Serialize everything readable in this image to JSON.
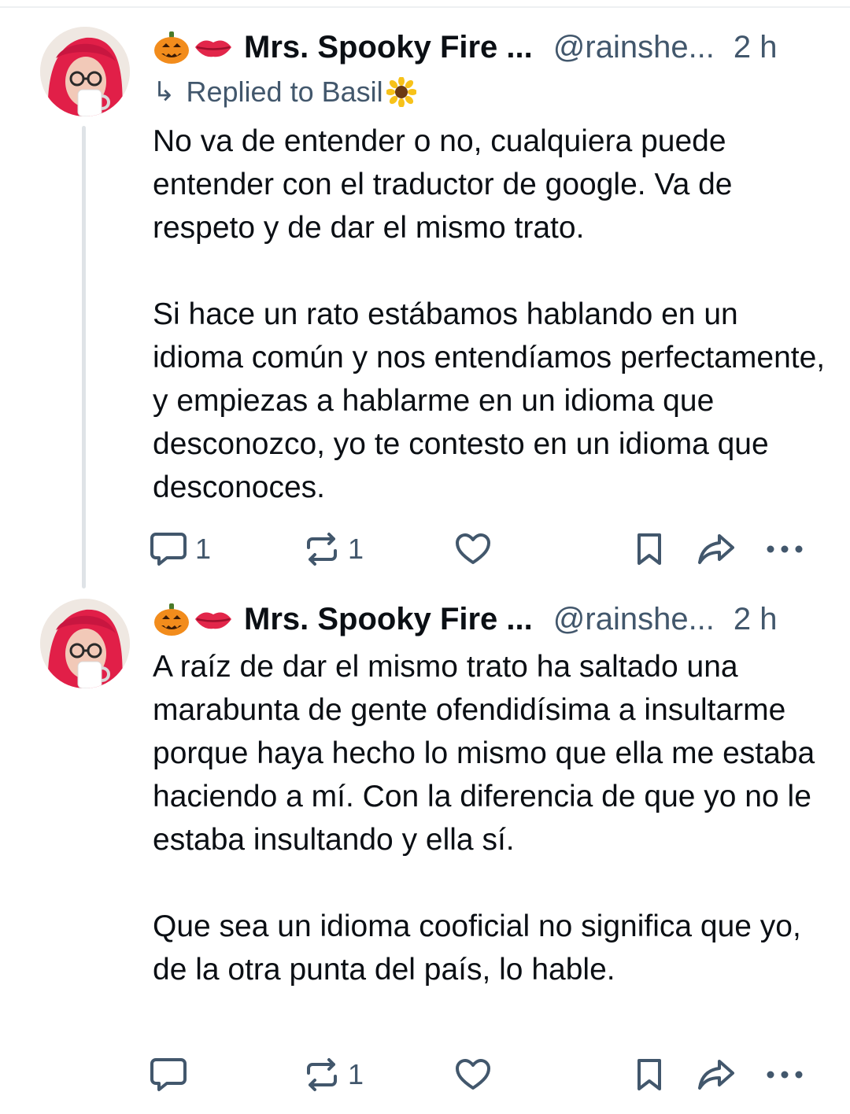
{
  "posts": [
    {
      "author_name": "Mrs. Spooky Fire ...",
      "handle": "@rainshe...",
      "time": "2 h",
      "emojis": [
        "pumpkin-icon",
        "lips-icon"
      ],
      "reply_to": "Replied to Basil",
      "reply_emoji": "sunflower-icon",
      "paragraphs": [
        "No va de entender o no, cualquiera puede entender con el traductor de google. Va de respeto y de dar el mismo trato.",
        "Si hace un rato estábamos hablando en un idioma común y nos entendíamos perfectamente, y empiezas a hablarme en un idioma que desconozco, yo te contesto en un idioma que desconoces."
      ],
      "reply_count": "1",
      "repost_count": "1"
    },
    {
      "author_name": "Mrs. Spooky Fire ...",
      "handle": "@rainshe...",
      "time": "2 h",
      "emojis": [
        "pumpkin-icon",
        "lips-icon"
      ],
      "paragraphs": [
        "A raíz de dar el mismo trato ha saltado una marabunta de gente ofendidísima a insultarme porque haya hecho lo mismo que ella me estaba haciendo a mí. Con la diferencia de que yo no le estaba insultando y ella sí.",
        "Que sea un idioma cooficial no significa que yo, de la otra punta del país, lo hable."
      ],
      "reply_count": "",
      "repost_count": "1"
    }
  ],
  "colors": {
    "text": "#0b0f14",
    "muted": "#42576c",
    "thread_line": "#dfe3e7",
    "avatar_hair": "#e8254f"
  }
}
